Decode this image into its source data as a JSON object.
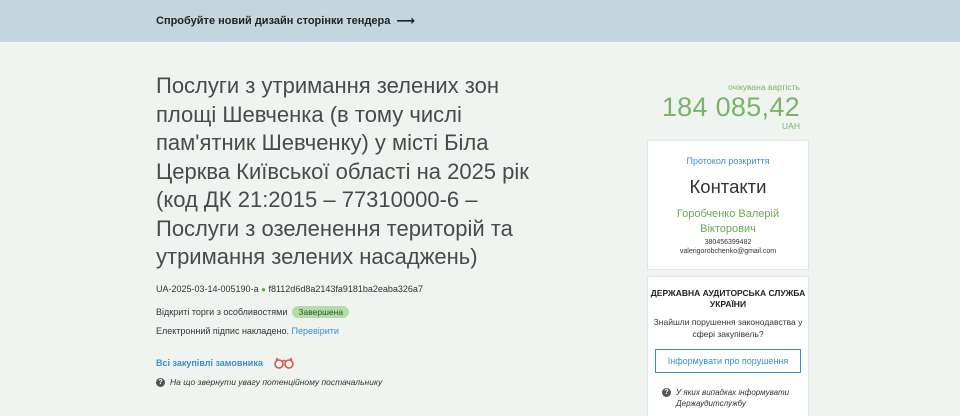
{
  "banner": {
    "text": "Спробуйте новий дизайн сторінки тендера",
    "arrow": "⟶"
  },
  "tender": {
    "title": "Послуги з утримання зелених зон площі Шевченка (в тому числі пам'ятник Шевченку) у місті Біла Церква Київської області на 2025 рік (код ДК 21:2015 – 77310000-6 – Послуги з озеленення територій та утримання зелених насаджень)",
    "id": "UA-2025-03-14-005190-a",
    "hash": "f8112d6d8a2143fa9181ba2eaba326a7",
    "procedure": "Відкриті торги з особливостями",
    "status": "Завершена",
    "sign_text": "Електронний підпис накладено.",
    "sign_link": "Перевірити",
    "all_purchases": "Всі закупівлі замовника",
    "hint": "На що звернути увагу потенційному постачальнику"
  },
  "expected": {
    "label": "очікувана вартість",
    "value": "184 085,42",
    "currency": "UAH"
  },
  "contacts": {
    "protocol_link": "Протокол розкриття",
    "title": "Контакти",
    "name": "Горобченко Валерій Вікторович",
    "phone": "380456399482",
    "email": "valerigorobchenko@gmail.com"
  },
  "audit": {
    "title": "ДЕРЖАВНА АУДИТОРСЬКА СЛУЖБА УКРАЇНИ",
    "text": "Знайшли порушення законодавства у сфері закупівель?",
    "button": "Інформувати про порушення",
    "hint": "У яких випадках інформувати Держаудитслужбу"
  },
  "colors": {
    "accent_green": "#7ab567",
    "link_blue": "#3a8fc8",
    "banner_bg": "#c5d5de",
    "page_bg": "#f0f4f1"
  }
}
